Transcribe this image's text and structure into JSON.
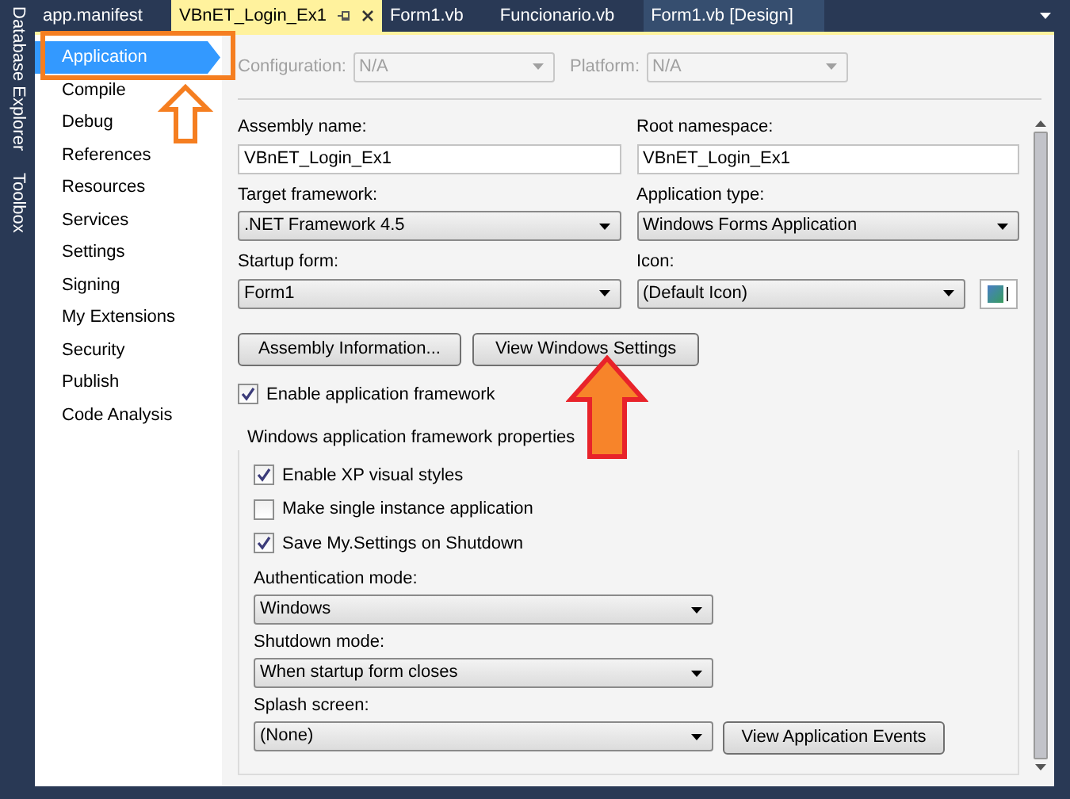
{
  "side_panel": [
    {
      "label": "Database Explorer"
    },
    {
      "label": "Toolbox"
    }
  ],
  "tabs": [
    {
      "label": "app.manifest",
      "selected": false
    },
    {
      "label": "VBnET_Login_Ex1",
      "selected": true
    },
    {
      "label": "Form1.vb",
      "selected": false
    },
    {
      "label": "Funcionario.vb",
      "selected": false
    },
    {
      "label": "Form1.vb [Design]",
      "selected": false
    }
  ],
  "sidebar": {
    "items": [
      {
        "label": "Application",
        "selected": true
      },
      {
        "label": "Compile",
        "selected": false
      },
      {
        "label": "Debug",
        "selected": false
      },
      {
        "label": "References",
        "selected": false
      },
      {
        "label": "Resources",
        "selected": false
      },
      {
        "label": "Services",
        "selected": false
      },
      {
        "label": "Settings",
        "selected": false
      },
      {
        "label": "Signing",
        "selected": false
      },
      {
        "label": "My Extensions",
        "selected": false
      },
      {
        "label": "Security",
        "selected": false
      },
      {
        "label": "Publish",
        "selected": false
      },
      {
        "label": "Code Analysis",
        "selected": false
      }
    ]
  },
  "config_bar": [
    {
      "label": "Configuration:",
      "value": "N/A",
      "disabled": true
    },
    {
      "label": "Platform:",
      "value": "N/A",
      "disabled": true
    }
  ],
  "fields": [
    {
      "kind": "text",
      "label": "Assembly name:",
      "value": "VBnET_Login_Ex1"
    },
    {
      "kind": "text",
      "label": "Root namespace:",
      "value": "VBnET_Login_Ex1"
    },
    {
      "kind": "select",
      "label": "Target framework:",
      "value": ".NET Framework 4.5"
    },
    {
      "kind": "select",
      "label": "Application type:",
      "value": "Windows Forms Application"
    },
    {
      "kind": "select",
      "label": "Startup form:",
      "value": "Form1"
    },
    {
      "kind": "icon",
      "label": "Icon:",
      "value": "(Default Icon)"
    }
  ],
  "buttons": [
    "Assembly Information...",
    "View Windows Settings"
  ],
  "enable_framework": {
    "label": "Enable application framework",
    "checked": true
  },
  "framework_group": {
    "title": "Windows application framework properties",
    "checkboxes": [
      {
        "label": "Enable XP visual styles",
        "checked": true
      },
      {
        "label": "Make single instance application",
        "checked": false
      },
      {
        "label": "Save My.Settings on Shutdown",
        "checked": true
      }
    ],
    "selects": [
      {
        "label": "Authentication mode:",
        "value": "Windows"
      },
      {
        "label": "Shutdown mode:",
        "value": "When startup form closes"
      },
      {
        "label": "Splash screen:",
        "value": "(None)",
        "button": "View Application Events"
      }
    ]
  }
}
